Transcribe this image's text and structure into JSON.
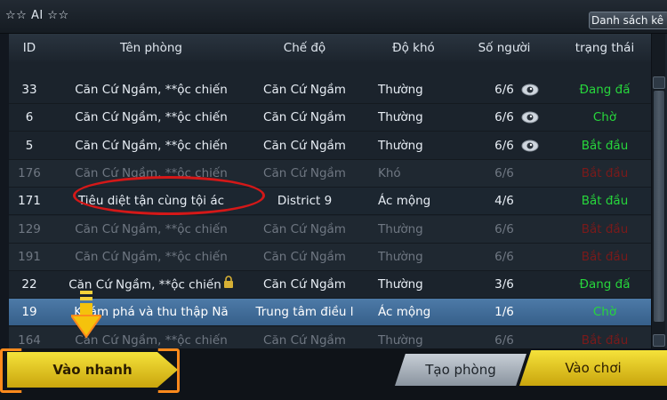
{
  "header": {
    "room_title": "☆☆ AI ☆☆",
    "list_tab": "Danh sách kê"
  },
  "columns": {
    "id": "ID",
    "name": "Tên phòng",
    "mode": "Chế độ",
    "difficulty": "Độ khó",
    "players": "Số người",
    "status": "trạng thái"
  },
  "rows": [
    {
      "id": "33",
      "name": "Căn Cứ Ngầm, **ộc chiến",
      "mode": "Căn Cứ Ngầm",
      "difficulty": "Thường",
      "players": "6/6",
      "eye": true,
      "status": "Đang đấ",
      "status_color": "green",
      "dim": false,
      "lock": false
    },
    {
      "id": "6",
      "name": "Căn Cứ Ngầm, **ộc chiến",
      "mode": "Căn Cứ Ngầm",
      "difficulty": "Thường",
      "players": "6/6",
      "eye": true,
      "status": "Chờ",
      "status_color": "green",
      "dim": false,
      "lock": false
    },
    {
      "id": "5",
      "name": "Căn Cứ Ngầm, **ộc chiến",
      "mode": "Căn Cứ Ngầm",
      "difficulty": "Thường",
      "players": "6/6",
      "eye": true,
      "status": "Bắt đầu",
      "status_color": "green",
      "dim": false,
      "lock": false
    },
    {
      "id": "176",
      "name": "Căn Cứ Ngầm, **ộc chiến",
      "mode": "Căn Cứ Ngầm",
      "difficulty": "Khó",
      "players": "6/6",
      "eye": false,
      "status": "Bắt đầu",
      "status_color": "red",
      "dim": true,
      "lock": false
    },
    {
      "id": "171",
      "name": "Tiêu diệt tận cùng tội ác",
      "mode": "District 9",
      "difficulty": "Ác mộng",
      "players": "4/6",
      "eye": false,
      "status": "Bắt đầu",
      "status_color": "green",
      "dim": false,
      "lock": false
    },
    {
      "id": "129",
      "name": "Căn Cứ Ngầm, **ộc chiến",
      "mode": "Căn Cứ Ngầm",
      "difficulty": "Thường",
      "players": "6/6",
      "eye": false,
      "status": "Bắt đầu",
      "status_color": "red",
      "dim": true,
      "lock": false
    },
    {
      "id": "191",
      "name": "Căn Cứ Ngầm, **ộc chiến",
      "mode": "Căn Cứ Ngầm",
      "difficulty": "Thường",
      "players": "6/6",
      "eye": false,
      "status": "Bắt đầu",
      "status_color": "red",
      "dim": true,
      "lock": false
    },
    {
      "id": "22",
      "name": "Căn Cứ Ngầm, **ộc chiến",
      "mode": "Căn Cứ Ngầm",
      "difficulty": "Thường",
      "players": "3/6",
      "eye": false,
      "status": "Đang đấ",
      "status_color": "green",
      "dim": false,
      "lock": true
    },
    {
      "id": "19",
      "name": "Khám phá và thu thập Nă",
      "mode": "Trung tâm điều l",
      "difficulty": "Ác mộng",
      "players": "1/6",
      "eye": false,
      "status": "Chờ",
      "status_color": "green",
      "dim": false,
      "lock": false,
      "selected": true
    },
    {
      "id": "164",
      "name": "Căn Cứ Ngầm, **ộc chiến",
      "mode": "Căn Cứ Ngầm",
      "difficulty": "Thường",
      "players": "6/6",
      "eye": false,
      "status": "Bắt đầu",
      "status_color": "red",
      "dim": true,
      "lock": false
    }
  ],
  "buttons": {
    "quick_join": "Vào nhanh",
    "create_room": "Tạo phòng",
    "play": "Vào chơi"
  },
  "colors": {
    "status_green": "#27d63c",
    "status_red": "#7a1a1a",
    "selected_row": "#4d7aa8",
    "highlight_ellipse": "#d41818",
    "gold_button": "#f5e23a"
  }
}
